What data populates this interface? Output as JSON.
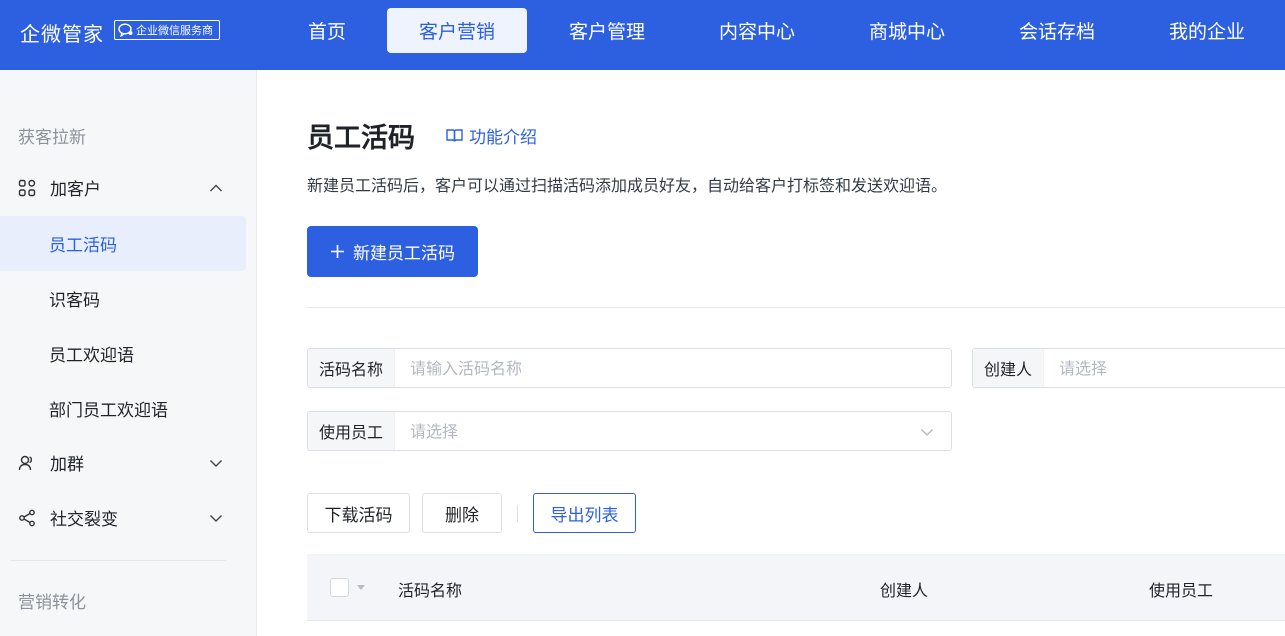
{
  "header": {
    "brand": "企微管家",
    "badge": "企业微信服务商",
    "nav": [
      {
        "label": "首页",
        "active": false
      },
      {
        "label": "客户营销",
        "active": true
      },
      {
        "label": "客户管理",
        "active": false
      },
      {
        "label": "内容中心",
        "active": false
      },
      {
        "label": "商城中心",
        "active": false
      },
      {
        "label": "会话存档",
        "active": false
      },
      {
        "label": "我的企业",
        "active": false
      }
    ]
  },
  "sidebar": {
    "section1": "获客拉新",
    "group_add_customer": "加客户",
    "items": [
      "员工活码",
      "识客码",
      "员工欢迎语",
      "部门员工欢迎语"
    ],
    "group_add_group": "加群",
    "group_social": "社交裂变",
    "section2": "营销转化"
  },
  "main": {
    "title": "员工活码",
    "intro_link": "功能介绍",
    "description": "新建员工活码后，客户可以通过扫描活码添加成员好友，自动给客户打标签和发送欢迎语。",
    "new_button": "新建员工活码",
    "filters": {
      "name_label": "活码名称",
      "name_placeholder": "请输入活码名称",
      "creator_label": "创建人",
      "creator_placeholder": "请选择",
      "employee_label": "使用员工",
      "employee_placeholder": "请选择"
    },
    "actions": {
      "download": "下载活码",
      "delete": "删除",
      "export": "导出列表"
    },
    "table": {
      "columns": [
        "活码名称",
        "创建人",
        "使用员工"
      ]
    }
  },
  "colors": {
    "primary": "#2d60e0",
    "sidebar_bg": "#f6f7f9",
    "active_item_bg": "#e8eefb"
  }
}
